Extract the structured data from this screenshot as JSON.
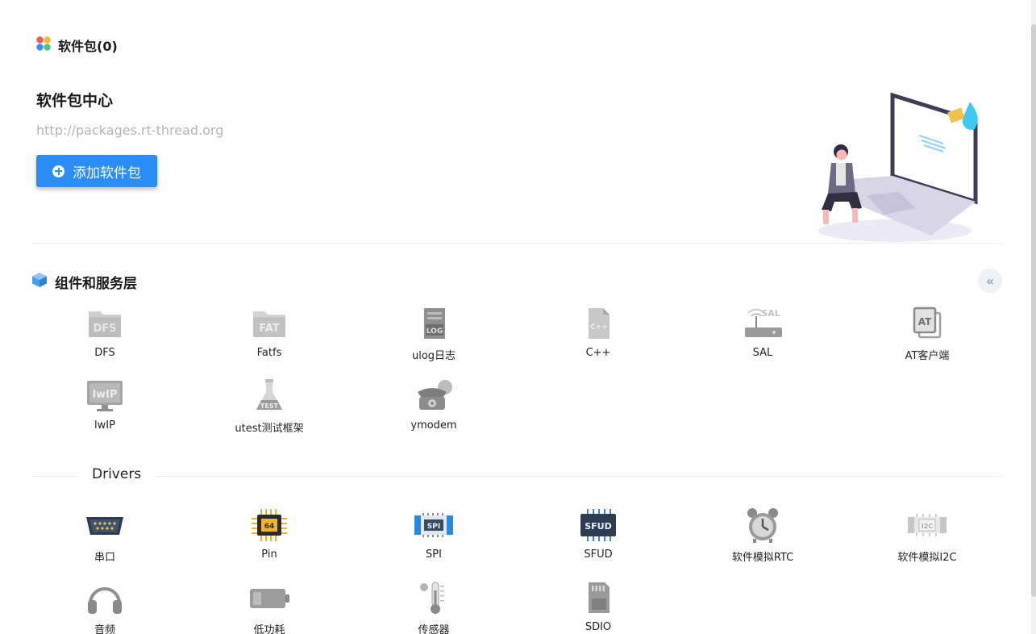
{
  "header": {
    "title": "软件包(0)",
    "icon": "package-grid-icon"
  },
  "center": {
    "title": "软件包中心",
    "url": "http://packages.rt-thread.org",
    "add_button": "添加软件包"
  },
  "components": {
    "title": "组件和服务层",
    "icon": "cube-icon",
    "collapse_glyph": "«",
    "items": [
      {
        "label": "DFS",
        "icon": "dfs-folder-icon"
      },
      {
        "label": "Fatfs",
        "icon": "fat-folder-icon"
      },
      {
        "label": "ulog日志",
        "icon": "log-document-icon"
      },
      {
        "label": "C++",
        "icon": "cpp-file-icon"
      },
      {
        "label": "SAL",
        "icon": "sal-router-icon"
      },
      {
        "label": "AT客户端",
        "icon": "at-client-icon"
      },
      {
        "label": "lwIP",
        "icon": "lwip-monitor-icon"
      },
      {
        "label": "utest测试框架",
        "icon": "test-flask-icon"
      },
      {
        "label": "ymodem",
        "icon": "telephone-icon"
      }
    ]
  },
  "drivers": {
    "title": "Drivers",
    "items": [
      {
        "label": "串口",
        "icon": "serial-port-icon"
      },
      {
        "label": "Pin",
        "icon": "chip-pin-icon"
      },
      {
        "label": "SPI",
        "icon": "spi-chip-icon"
      },
      {
        "label": "SFUD",
        "icon": "sfud-chip-icon"
      },
      {
        "label": "软件模拟RTC",
        "icon": "alarm-clock-icon"
      },
      {
        "label": "软件模拟I2C",
        "icon": "i2c-chip-icon"
      },
      {
        "label": "音频",
        "icon": "headphones-icon"
      },
      {
        "label": "低功耗",
        "icon": "battery-icon"
      },
      {
        "label": "传感器",
        "icon": "thermometer-icon"
      },
      {
        "label": "SDIO",
        "icon": "sd-card-icon"
      }
    ]
  },
  "colors": {
    "primary": "#2a8cf5",
    "url_gray": "#b4b4b4"
  }
}
